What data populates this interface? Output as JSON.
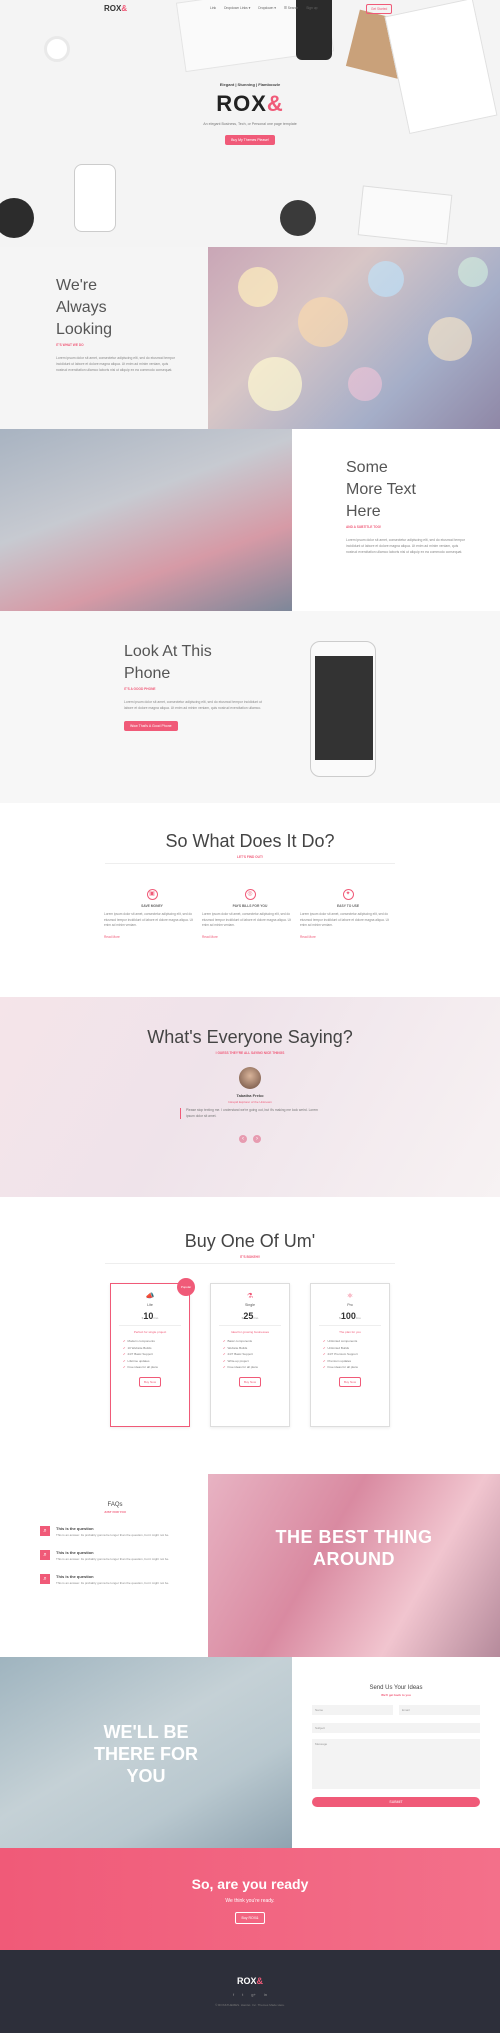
{
  "nav": {
    "logo": "ROX",
    "logo_accent": "&",
    "links": [
      "Link",
      "Dropdown Links ▾",
      "Dropdown ▾",
      "☰ Search",
      "Sign up"
    ],
    "cta": "Get Started"
  },
  "hero": {
    "tagline": "Elegant | Stunning | Flamboozle",
    "title": "ROX",
    "title_accent": "&",
    "description": "An elegant Business, Tech, or Personal one page template",
    "button": "Buy My Themes Please!"
  },
  "section1": {
    "title_lines": [
      "We're",
      "Always",
      "Looking"
    ],
    "subtitle": "It's what we do",
    "paragraph": "Lorem ipsum dolor sit amet, consectetur adipiscing elit, sed do eiusmod tempor incididunt ut labore et dolore magna aliqua. Ut enim ad minim veniam, quis nostrud exercitation ullamco laboris nisi ut aliquip ex ea commodo consequat."
  },
  "section2": {
    "title_lines": [
      "Some",
      "More Text",
      "Here"
    ],
    "subtitle": "And a subtitle too!",
    "paragraph": "Lorem ipsum dolor sit amet, consectetur adipiscing elit, sed do eiusmod tempor incididunt ut labore et dolore magna aliqua. Ut enim ad minim veniam, quis nostrud exercitation ullamco laboris nisi ut aliquip ex ea commodo consequat."
  },
  "section3": {
    "title_lines": [
      "Look At This",
      "Phone"
    ],
    "subtitle": "It's a good phone",
    "paragraph": "Lorem ipsum dolor sit amet, consectetur adipiscing elit, sed do eiusmod tempor incididunt ut labore et dolore magna aliqua. Ut enim ad minim veniam, quis nostrud exercitation ullamco.",
    "button": "Wow That's A Good Phone"
  },
  "features": {
    "title": "So What Does It Do?",
    "subtitle": "Let's find out!",
    "items": [
      {
        "icon": "briefcase-icon",
        "glyph": "▣",
        "title": "Save Money",
        "text": "Lorem ipsum dolor sit amet, consectetur adipiscing elit, sed do eiusmod tempor incididunt ut labore et dolore magna aliqua. Ut enim ad minim veniam.",
        "more": "Read More"
      },
      {
        "icon": "car-icon",
        "glyph": "◎",
        "title": "Pays Bills For You",
        "text": "Lorem ipsum dolor sit amet, consectetur adipiscing elit, sed do eiusmod tempor incididunt ut labore et dolore magna aliqua. Ut enim ad minim veniam.",
        "more": "Read More"
      },
      {
        "icon": "compass-icon",
        "glyph": "✦",
        "title": "Easy To Use",
        "text": "Lorem ipsum dolor sit amet, consectetur adipiscing elit, sed do eiusmod tempor incididunt ut labore et dolore magna aliqua. Ut enim ad minim veniam.",
        "more": "Read More"
      }
    ]
  },
  "testimonials": {
    "title": "What's Everyone Saying?",
    "subtitle": "I guess they're all saying nice things",
    "name": "Tabatha Freko",
    "role": "Intrepid Explorer of the Unknown",
    "quote": "Please stop texting me. I understand we're going out, but it's making me look weird. Lorem ipsum dolor sit amet.",
    "prev": "‹",
    "next": "›"
  },
  "pricing": {
    "title": "Buy One Of Um'",
    "subtitle": "It's Bokeh!!",
    "plans": [
      {
        "icon": "megaphone-icon",
        "glyph": "📣",
        "name": "Lite",
        "currency": "$",
        "price": "10",
        "period": "/mo",
        "header": "Perfect for single project",
        "features": [
          "Modern components",
          "10 Website Builds",
          "24/7 Basic Support",
          "Lifetime updates",
          "Free ideas for all plans"
        ],
        "button": "Buy Now",
        "badge": "Popular"
      },
      {
        "icon": "flask-icon",
        "glyph": "⚗",
        "name": "Single",
        "currency": "$",
        "price": "25",
        "period": "/mo",
        "header": "Ideal for growing businesses",
        "features": [
          "Basic components",
          "Website Builds",
          "24/7 Basic Support",
          "Write-up project",
          "Free ideas for all plans"
        ],
        "button": "Buy Now"
      },
      {
        "icon": "atom-icon",
        "glyph": "⚛",
        "name": "Pro",
        "currency": "$",
        "price": "100",
        "period": "/mo",
        "header": "The plan for you",
        "features": [
          "Unlimited components",
          "Unlimited Builds",
          "24/7 Premium Support",
          "Premium updates",
          "Free ideas for all plans"
        ],
        "button": "Buy Now"
      }
    ]
  },
  "faq": {
    "title": "FAQs",
    "subtitle": "Just for you",
    "items": [
      {
        "q": "This is the question",
        "a": "This is an answer. Its probably gonna be longer than the question, but it might not be."
      },
      {
        "q": "This is the question",
        "a": "This is an answer. Its probably gonna be longer than the question, but it might not be."
      },
      {
        "q": "This is the question",
        "a": "This is an answer. Its probably gonna be longer than the question, but it might not be."
      }
    ],
    "banner": "THE BEST THING AROUND"
  },
  "contact": {
    "banner": "WE'LL BE THERE FOR YOU",
    "title": "Send Us Your Ideas",
    "subtitle": "We'll get back to you",
    "name_placeholder": "Name",
    "email_placeholder": "Email",
    "subject_placeholder": "Subject",
    "message_placeholder": "Message",
    "submit": "SUBMIT"
  },
  "ready": {
    "title": "So, are you ready",
    "subtitle": "We think you're ready.",
    "button": "Buy ROX&"
  },
  "footer": {
    "logo": "ROX",
    "logo_accent": "&",
    "social": [
      "f",
      "t",
      "g+",
      "in"
    ],
    "copyright": "© ROX&THEMES. Hamlet. Inc. Themes Made Here."
  }
}
